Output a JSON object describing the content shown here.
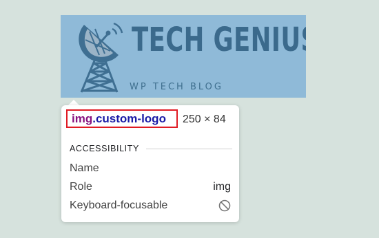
{
  "logo": {
    "title": "TECH GENIUS",
    "subtitle": "WP TECH BLOG",
    "icon": "satellite-dish-tower-icon"
  },
  "tooltip": {
    "selector_tag": "img",
    "selector_class": ".custom-logo",
    "dimensions": "250 × 84",
    "section_title": "ACCESSIBILITY",
    "properties": [
      {
        "label": "Name",
        "value": ""
      },
      {
        "label": "Role",
        "value": "img"
      },
      {
        "label": "Keyboard-focusable",
        "value": "",
        "icon": "prohibited-icon"
      }
    ]
  },
  "colors": {
    "page_background": "#d6e2dd",
    "logo_background": "#8fbad8",
    "logo_text": "#3b6a8c",
    "highlight_border": "#e01b24",
    "tag_color": "#881280",
    "class_color": "#1a1aa6"
  }
}
